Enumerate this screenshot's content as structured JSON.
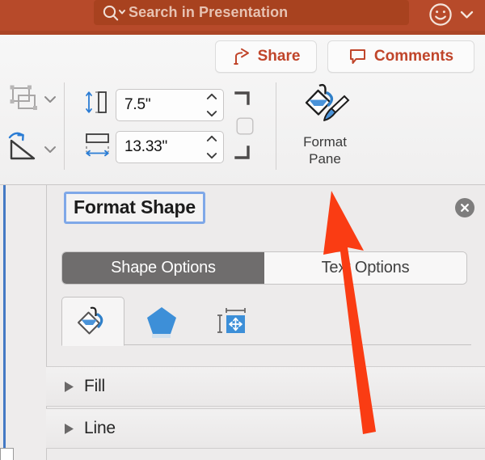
{
  "colors": {
    "brand_red": "#b74a2a",
    "search_field": "#a8421f",
    "accent_text": "#c0452a",
    "annotation_arrow": "#fa3c13",
    "tab_active_bg": "#6f6d6d",
    "title_focus_border": "#7fa8e8",
    "slide_edge_blue": "#4479c4"
  },
  "topbar": {
    "search": {
      "placeholder": "Search in Presentation",
      "value": "",
      "icon": "search-icon",
      "dropdown_icon": "chevron-down-icon"
    },
    "account": {
      "icon": "smiley-face-icon",
      "dropdown_icon": "chevron-down-icon"
    }
  },
  "ribbon": {
    "share_button": {
      "label": "Share",
      "icon": "share-arrow-icon"
    },
    "comments_button": {
      "label": "Comments",
      "icon": "comment-bubble-icon"
    },
    "arrange_group": {
      "arrange_icon": "arrange-objects-icon",
      "arrange_dropdown_icon": "chevron-down-icon",
      "rotate_icon": "rotate-shape-icon",
      "rotate_dropdown_icon": "chevron-down-icon"
    },
    "size_group": {
      "height": {
        "label_icon": "shape-height-icon",
        "value": "7.5\"",
        "stepper_up_icon": "chevron-up-icon",
        "stepper_down_icon": "chevron-down-icon"
      },
      "width": {
        "label_icon": "shape-width-icon",
        "value": "13.33\"",
        "stepper_up_icon": "chevron-up-icon",
        "stepper_down_icon": "chevron-down-icon"
      },
      "crop_top_icon": "crop-corner-top-icon",
      "crop_bottom_icon": "crop-corner-bottom-icon",
      "size_dialog_button_icon": "square-button-icon"
    },
    "format_pane_button": {
      "line1": "Format",
      "line2": "Pane",
      "icon": "paint-bucket-brush-icon"
    }
  },
  "panel": {
    "title": "Format Shape",
    "close_button_icon": "close-circle-icon",
    "tabs": [
      {
        "label": "Shape Options",
        "active": true
      },
      {
        "label": "Text Options",
        "active": false
      }
    ],
    "icon_tabs": [
      {
        "name": "fill-and-line-icon",
        "active": true
      },
      {
        "name": "effects-pentagon-icon",
        "active": false
      },
      {
        "name": "size-and-properties-icon",
        "active": false
      }
    ],
    "sections": [
      {
        "label": "Fill",
        "expanded": false,
        "disclosure_icon": "triangle-right-icon"
      },
      {
        "label": "Line",
        "expanded": false,
        "disclosure_icon": "triangle-right-icon"
      }
    ]
  },
  "workspace": {
    "slide_edge_handle_icon": "resize-handle-icon"
  },
  "annotation": {
    "arrow_icon": "up-arrow-annotation-icon",
    "points_to": "Format Pane"
  }
}
